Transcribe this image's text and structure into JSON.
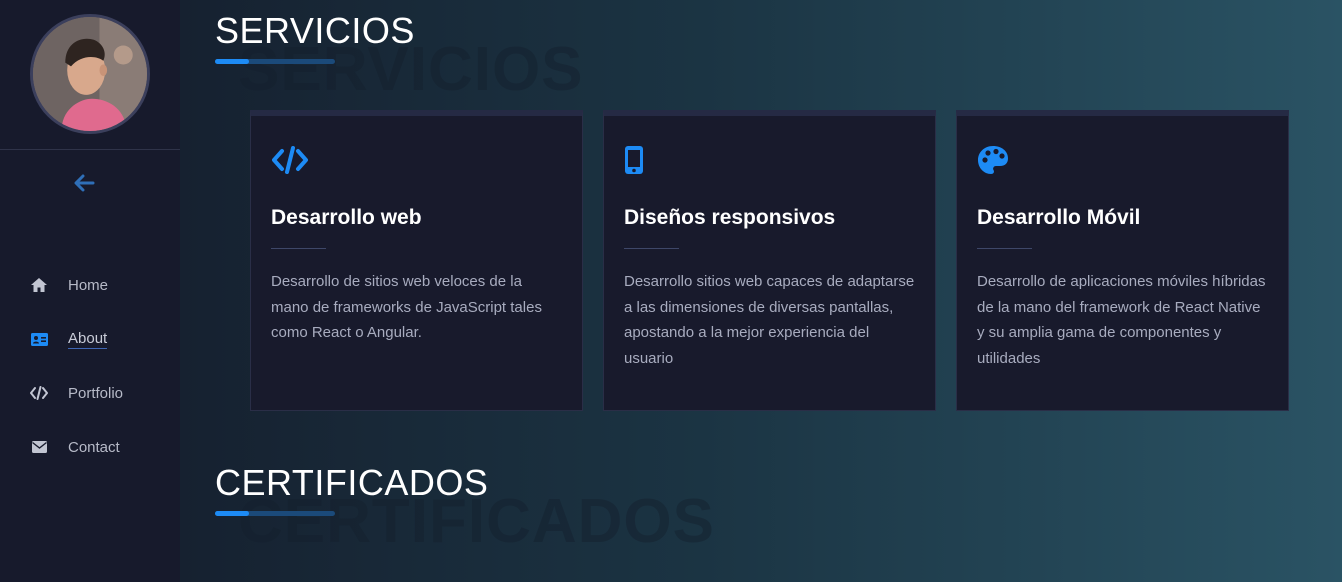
{
  "sidebar": {
    "nav": [
      {
        "label": "Home",
        "icon": "home-icon"
      },
      {
        "label": "About",
        "icon": "id-card-icon"
      },
      {
        "label": "Portfolio",
        "icon": "code-icon"
      },
      {
        "label": "Contact",
        "icon": "envelope-icon"
      }
    ],
    "active_item": "About"
  },
  "sections": {
    "services": {
      "title": "SERVICIOS",
      "ghost": "SERVICIOS"
    },
    "certificates": {
      "title": "CERTIFICADOS",
      "ghost": "CERTIFICADOS"
    }
  },
  "cards": [
    {
      "icon": "code-icon",
      "title": "Desarrollo web",
      "text": "Desarrollo de sitios web veloces de la mano de frameworks de JavaScript tales como React o Angular."
    },
    {
      "icon": "mobile-icon",
      "title": "Diseños responsivos",
      "text": "Desarrollo sitios web capaces de adaptarse a las dimensiones de diversas pantallas, apostando a la mejor experiencia del usuario"
    },
    {
      "icon": "palette-icon",
      "title": "Desarrollo Móvil",
      "text": "Desarrollo de aplicaciones móviles híbridas de la mano del framework de React Native y su amplia gama de componentes y utilidades"
    }
  ],
  "colors": {
    "accent": "#1d8bf5",
    "sidebar_bg": "#171a2c",
    "card_bg": "#181a2c"
  }
}
